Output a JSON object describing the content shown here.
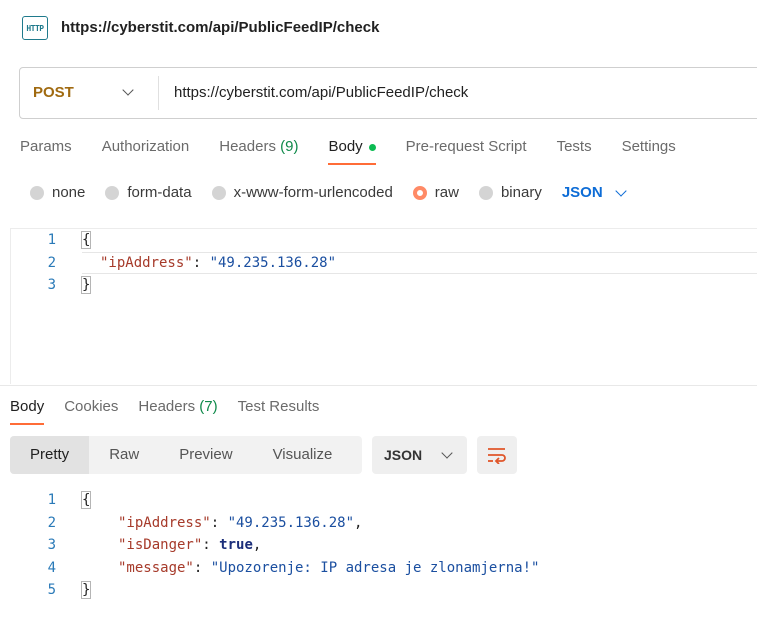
{
  "title": {
    "icon_text": "HTTP",
    "url": "https://cyberstit.com/api/PublicFeedIP/check"
  },
  "request": {
    "method": "POST",
    "url": "https://cyberstit.com/api/PublicFeedIP/check",
    "tabs": [
      {
        "label": "Params",
        "count": ""
      },
      {
        "label": "Authorization",
        "count": ""
      },
      {
        "label": "Headers",
        "count": "(9)"
      },
      {
        "label": "Body",
        "count": ""
      },
      {
        "label": "Pre-request Script",
        "count": ""
      },
      {
        "label": "Tests",
        "count": ""
      },
      {
        "label": "Settings",
        "count": ""
      }
    ],
    "active_tab": "Body",
    "body_types": [
      "none",
      "form-data",
      "x-www-form-urlencoded",
      "raw",
      "binary"
    ],
    "selected_body_type": "raw",
    "body_format": "JSON",
    "editor": {
      "line_numbers": [
        "1",
        "2",
        "3"
      ],
      "open_brace": "{",
      "close_brace": "}",
      "key": "\"ipAddress\"",
      "colon": ": ",
      "value": "\"49.235.136.28\""
    }
  },
  "response": {
    "tabs": [
      {
        "label": "Body",
        "count": ""
      },
      {
        "label": "Cookies",
        "count": ""
      },
      {
        "label": "Headers",
        "count": "(7)"
      },
      {
        "label": "Test Results",
        "count": ""
      }
    ],
    "active_tab": "Body",
    "view_modes": [
      "Pretty",
      "Raw",
      "Preview",
      "Visualize"
    ],
    "active_view": "Pretty",
    "format": "JSON",
    "editor": {
      "line_numbers": [
        "1",
        "2",
        "3",
        "4",
        "5"
      ],
      "open_brace": "{",
      "close_brace": "}",
      "lines": [
        {
          "key": "\"ipAddress\"",
          "colon": ": ",
          "value": "\"49.235.136.28\"",
          "comma": ","
        },
        {
          "key": "\"isDanger\"",
          "colon": ": ",
          "value": "true",
          "comma": ","
        },
        {
          "key": "\"message\"",
          "colon": ": ",
          "value": "\"Upozorenje: IP adresa je zlonamjerna!\"",
          "comma": ""
        }
      ]
    }
  },
  "colors": {
    "accent": "#ff6c37",
    "method": "#a06a10",
    "link": "#0d6cd6",
    "count": "#0f8a4a"
  }
}
